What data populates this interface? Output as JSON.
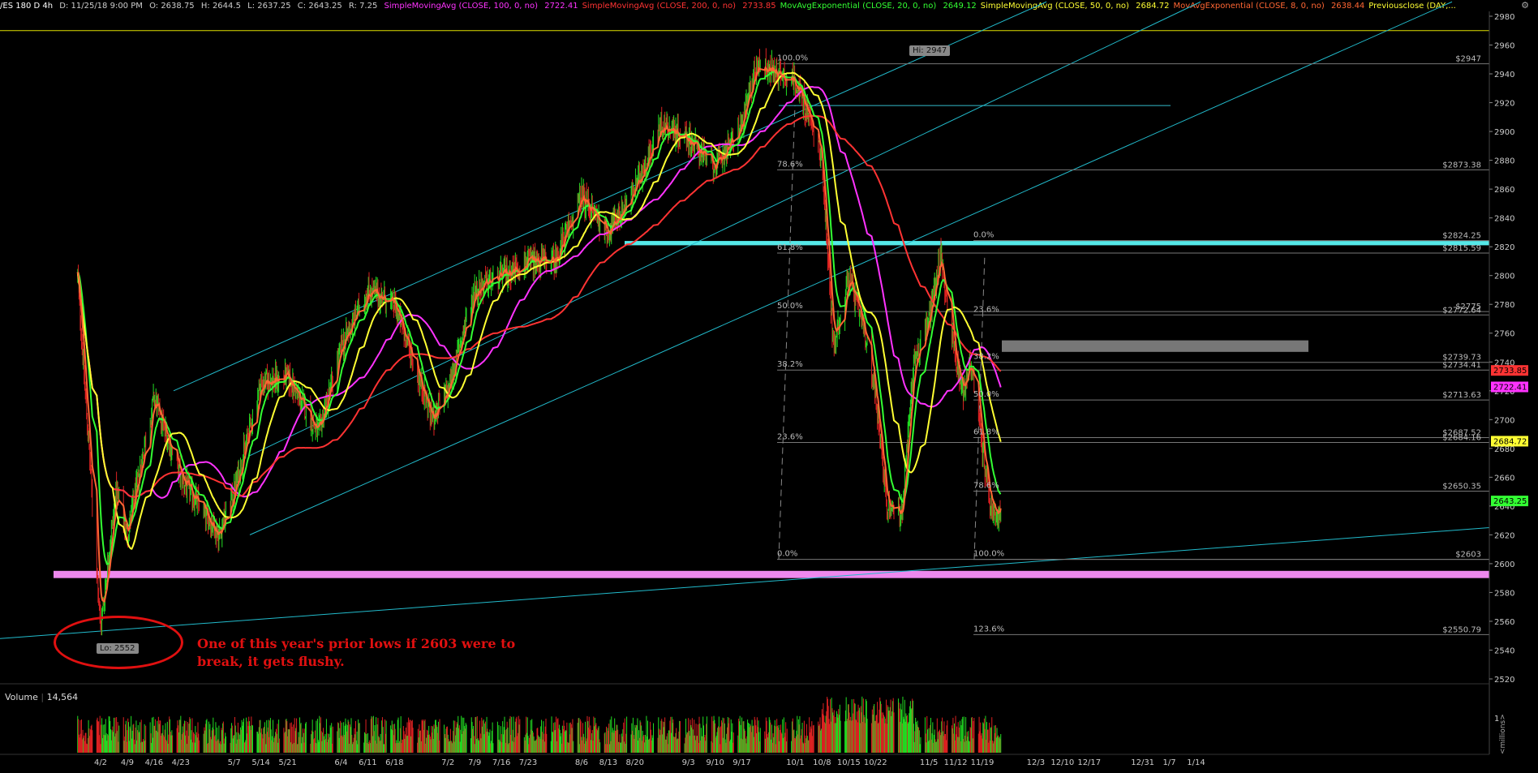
{
  "header": {
    "symbol": "/ES 180 D 4h",
    "date": "D: 11/25/18 9:00 PM",
    "open": "O: 2638.75",
    "high": "H: 2644.5",
    "low": "L: 2637.25",
    "close": "C: 2643.25",
    "range": "R: 7.25",
    "studies": [
      {
        "label": "SimpleMovingAvg (CLOSE, 100, 0, no)",
        "value": "2722.41",
        "color": "#ff33ff"
      },
      {
        "label": "SimpleMovingAvg (CLOSE, 200, 0, no)",
        "value": "2733.85",
        "color": "#ff3333"
      },
      {
        "label": "MovAvgExponential (CLOSE, 20, 0, no)",
        "value": "2649.12",
        "color": "#33ff33"
      },
      {
        "label": "SimpleMovingAvg (CLOSE, 50, 0, no)",
        "value": "2684.72",
        "color": "#ffff33"
      },
      {
        "label": "MovAvgExponential (CLOSE, 8, 0, no)",
        "value": "2638.44",
        "color": "#ff6633"
      },
      {
        "label": "Previousclose (DAY,...",
        "value": "",
        "color": "#ffff33"
      }
    ]
  },
  "chart_data": {
    "type": "line",
    "title": "/ES 180 D 4h",
    "y_ticks": [
      2520,
      2540,
      2560,
      2580,
      2600,
      2620,
      2640,
      2660,
      2680,
      2700,
      2720,
      2740,
      2760,
      2780,
      2800,
      2820,
      2840,
      2860,
      2880,
      2900,
      2920,
      2940,
      2960,
      2980
    ],
    "x_ticks": [
      "4/2",
      "4/9",
      "4/16",
      "4/23",
      "5/7",
      "5/14",
      "5/21",
      "6/4",
      "6/11",
      "6/18",
      "7/2",
      "7/9",
      "7/16",
      "7/23",
      "8/6",
      "8/13",
      "8/20",
      "9/3",
      "9/10",
      "9/17",
      "10/1",
      "10/8",
      "10/15",
      "10/22",
      "11/5",
      "11/12",
      "11/19",
      "12/3",
      "12/10",
      "12/17",
      "12/31",
      "1/7",
      "1/14"
    ],
    "price_path": [
      [
        "3/27",
        2800
      ],
      [
        "4/2",
        2555
      ],
      [
        "4/6",
        2650
      ],
      [
        "4/9",
        2620
      ],
      [
        "4/16",
        2715
      ],
      [
        "4/23",
        2660
      ],
      [
        "5/3",
        2620
      ],
      [
        "5/7",
        2650
      ],
      [
        "5/14",
        2725
      ],
      [
        "5/21",
        2730
      ],
      [
        "5/29",
        2690
      ],
      [
        "6/4",
        2750
      ],
      [
        "6/11",
        2790
      ],
      [
        "6/18",
        2780
      ],
      [
        "6/28",
        2700
      ],
      [
        "7/2",
        2720
      ],
      [
        "7/9",
        2790
      ],
      [
        "7/16",
        2800
      ],
      [
        "7/23",
        2810
      ],
      [
        "7/30",
        2810
      ],
      [
        "8/6",
        2855
      ],
      [
        "8/13",
        2830
      ],
      [
        "8/20",
        2860
      ],
      [
        "8/27",
        2905
      ],
      [
        "9/3",
        2895
      ],
      [
        "9/10",
        2875
      ],
      [
        "9/17",
        2905
      ],
      [
        "9/21",
        2947
      ],
      [
        "10/1",
        2935
      ],
      [
        "10/4",
        2915
      ],
      [
        "10/8",
        2880
      ],
      [
        "10/11",
        2750
      ],
      [
        "10/15",
        2800
      ],
      [
        "10/19",
        2760
      ],
      [
        "10/22",
        2720
      ],
      [
        "10/25",
        2640
      ],
      [
        "10/29",
        2635
      ],
      [
        "11/1",
        2740
      ],
      [
        "11/5",
        2770
      ],
      [
        "11/8",
        2815
      ],
      [
        "11/12",
        2740
      ],
      [
        "11/14",
        2720
      ],
      [
        "11/16",
        2740
      ],
      [
        "11/19",
        2680
      ],
      [
        "11/21",
        2640
      ],
      [
        "11/23",
        2630
      ],
      [
        "11/25",
        2643.25
      ]
    ],
    "series": [
      {
        "name": "SimpleMovingAvg (CLOSE, 100, 0, no)",
        "color": "#ff33ff",
        "last": 2722.41
      },
      {
        "name": "SimpleMovingAvg (CLOSE, 200, 0, no)",
        "color": "#ff3333",
        "last": 2733.85
      },
      {
        "name": "MovAvgExponential (CLOSE, 20, 0, no)",
        "color": "#33ff33",
        "last": 2649.12
      },
      {
        "name": "SimpleMovingAvg (CLOSE, 50, 0, no)",
        "color": "#ffff33",
        "last": 2684.72
      },
      {
        "name": "MovAvgExponential (CLOSE, 8, 0, no)",
        "color": "#ff6633",
        "last": 2638.44
      }
    ],
    "last_price": 2643.25,
    "price_badges": [
      {
        "value": "2733.85",
        "color": "#ff3333"
      },
      {
        "value": "2722.41",
        "color": "#ff33ff"
      },
      {
        "value": "2684.72",
        "color": "#ffff33"
      },
      {
        "value": "2643.25",
        "color": "#33ff33"
      }
    ],
    "hi_label": "Hi: 2947",
    "lo_label": "Lo: 2552",
    "fib_levels_right": [
      {
        "label": "$2947",
        "value": 2947
      },
      {
        "label": "$2873.38",
        "value": 2873.38
      },
      {
        "label": "$2824.25",
        "value": 2824.25
      },
      {
        "label": "$2815.59",
        "value": 2815.59
      },
      {
        "label": "$2775",
        "value": 2775
      },
      {
        "label": "$2772.64",
        "value": 2772.64
      },
      {
        "label": "$2739.73",
        "value": 2739.73
      },
      {
        "label": "$2734.41",
        "value": 2734.41
      },
      {
        "label": "$2713.63",
        "value": 2713.63
      },
      {
        "label": "$2687.52",
        "value": 2687.52
      },
      {
        "label": "$2684.16",
        "value": 2684.16
      },
      {
        "label": "$2650.35",
        "value": 2650.35
      },
      {
        "label": "$2603",
        "value": 2603
      },
      {
        "label": "$2550.79",
        "value": 2550.79
      }
    ],
    "fib_left_pcts": [
      {
        "label": "100.0%",
        "value": 2947
      },
      {
        "label": "78.6%",
        "value": 2873.38
      },
      {
        "label": "61.8%",
        "value": 2815.59
      },
      {
        "label": "50.0%",
        "value": 2775
      },
      {
        "label": "38.2%",
        "value": 2734.41
      },
      {
        "label": "23.6%",
        "value": 2684.16
      },
      {
        "label": "0.0%",
        "value": 2603
      }
    ],
    "fib_mid_pcts": [
      {
        "label": "0.0%",
        "value": 2824.25
      },
      {
        "label": "23.6%",
        "value": 2772.64
      },
      {
        "label": "38.2%",
        "value": 2739.73
      },
      {
        "label": "50.0%",
        "value": 2713.63
      },
      {
        "label": "61.8%",
        "value": 2687.52
      },
      {
        "label": "78.6%",
        "value": 2650.35
      },
      {
        "label": "100.0%",
        "value": 2603
      },
      {
        "label": "123.6%",
        "value": 2550.79
      }
    ],
    "annotation": "One of this year's prior lows if 2603 were to break, it gets flushy.",
    "volume_label": "Volume",
    "volume_value": "14,564",
    "volume_axis_label": "<millions>",
    "volume_ticks": [
      "1"
    ],
    "grid": false
  }
}
